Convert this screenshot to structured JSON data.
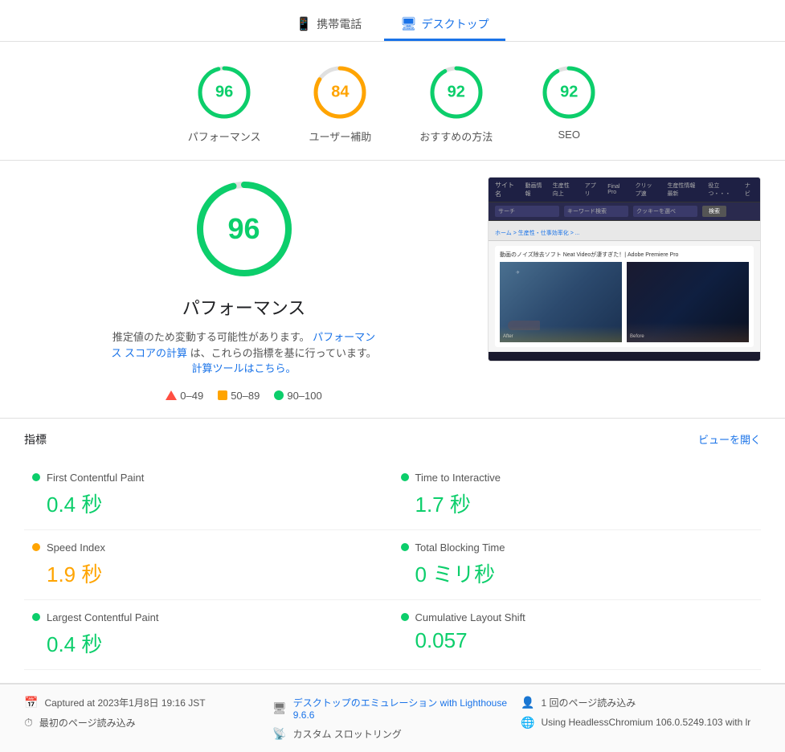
{
  "tabs": {
    "mobile": {
      "label": "携帯電話",
      "icon": "📱"
    },
    "desktop": {
      "label": "デスクトップ",
      "icon": "🖥",
      "active": true
    }
  },
  "scores": [
    {
      "label": "パフォーマンス",
      "value": "96",
      "color": "green",
      "percent": 96
    },
    {
      "label": "ユーザー補助",
      "value": "84",
      "color": "orange",
      "percent": 84
    },
    {
      "label": "おすすめの方法",
      "value": "92",
      "color": "green",
      "percent": 92
    },
    {
      "label": "SEO",
      "value": "92",
      "color": "green",
      "percent": 92
    }
  ],
  "performance": {
    "score": "96",
    "title": "パフォーマンス",
    "description": "推定値のため変動する可能性があります。",
    "link1": "パフォーマンス スコアの計算",
    "description2": "は、これらの指標を基に行っています。",
    "link2": "計算ツールはこちら。",
    "legend": [
      {
        "type": "triangle",
        "range": "0–49"
      },
      {
        "type": "square",
        "range": "50–89"
      },
      {
        "type": "dot",
        "range": "90–100"
      }
    ]
  },
  "metrics": {
    "title": "指標",
    "view_label": "ビューを開く",
    "items": [
      {
        "name": "First Contentful Paint",
        "value": "0.4 秒",
        "color": "green",
        "col": 0
      },
      {
        "name": "Time to Interactive",
        "value": "1.7 秒",
        "color": "green",
        "col": 1
      },
      {
        "name": "Speed Index",
        "value": "1.9 秒",
        "color": "orange",
        "col": 0
      },
      {
        "name": "Total Blocking Time",
        "value": "0 ミリ秒",
        "color": "green",
        "col": 1
      },
      {
        "name": "Largest Contentful Paint",
        "value": "0.4 秒",
        "color": "green",
        "col": 0
      },
      {
        "name": "Cumulative Layout Shift",
        "value": "0.057",
        "color": "green",
        "col": 1
      }
    ]
  },
  "footer": {
    "rows": [
      [
        {
          "icon": "📅",
          "text": "Captured at 2023年1月8日 19:16 JST"
        },
        {
          "icon": "⏱",
          "text": "最初のページ読み込み"
        }
      ],
      [
        {
          "icon": "🖥",
          "text": "デスクトップのエミュレーション with Lighthouse 9.6.6",
          "link": true
        },
        {
          "icon": "📡",
          "text": "カスタム スロットリング"
        }
      ],
      [
        {
          "icon": "👤",
          "text": "1 回のページ読み込み"
        },
        {
          "icon": "🌐",
          "text": "Using HeadlessChromium 106.0.5249.103 with lr"
        }
      ]
    ]
  }
}
